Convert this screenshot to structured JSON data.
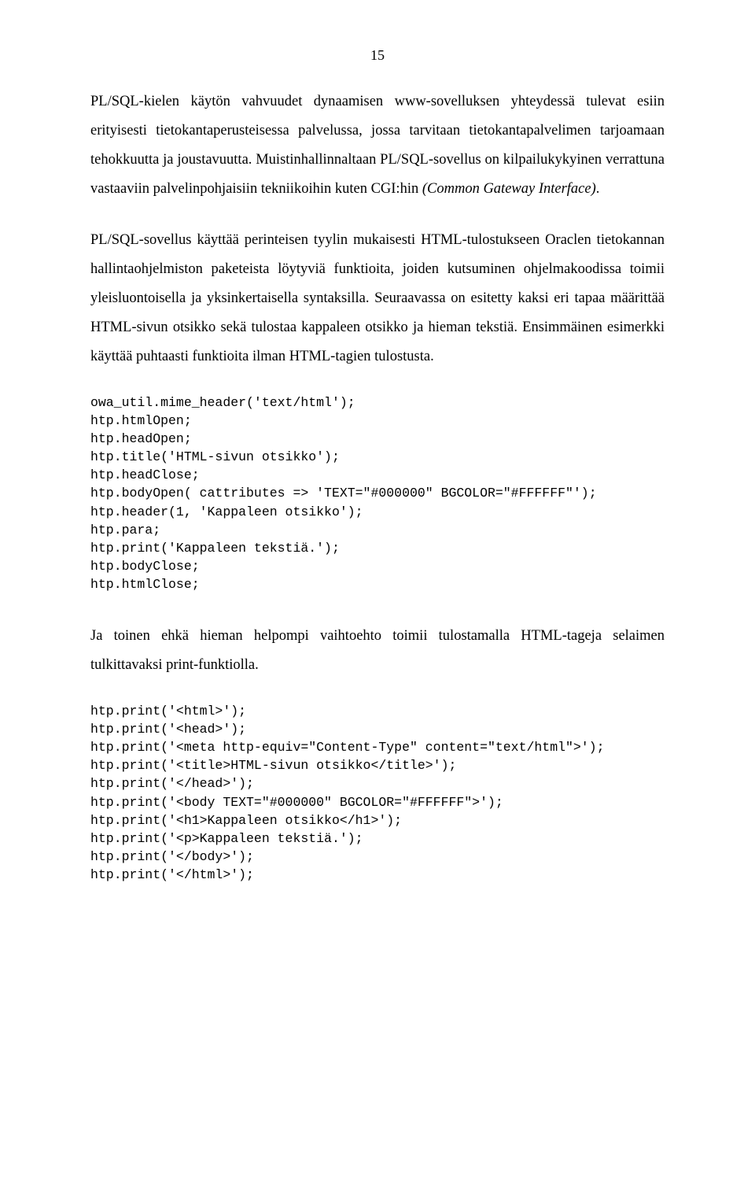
{
  "pageNumber": "15",
  "para1": "PL/SQL-kielen käytön vahvuudet dynaamisen www-sovelluksen yhteydessä tulevat esiin erityisesti tietokantaperusteisessa palvelussa, jossa tarvitaan tietokantapalvelimen tarjoamaan tehokkuutta ja joustavuutta. Muistinhallinnaltaan PL/SQL-sovellus on kilpailukykyinen verrattuna vastaaviin palvelinpohjaisiin tekniikoihin kuten CGI:hin ",
  "para1_italic": "(Common Gateway Interface)",
  "para1_end": ".",
  "para2": "PL/SQL-sovellus käyttää perinteisen tyylin mukaisesti HTML-tulostukseen Oraclen tietokannan hallintaohjelmiston paketeista löytyviä funktioita, joiden kutsuminen ohjelmakoodissa toimii yleisluontoisella ja yksinkertaisella syntaksilla. Seuraavassa on esitetty kaksi eri tapaa määrittää HTML-sivun otsikko sekä tulostaa kappaleen otsikko ja hieman tekstiä. Ensimmäinen esimerkki käyttää puhtaasti funktioita ilman HTML-tagien tulostusta.",
  "code1": "owa_util.mime_header('text/html');\nhtp.htmlOpen;\nhtp.headOpen;\nhtp.title('HTML-sivun otsikko');\nhtp.headClose;\nhtp.bodyOpen( cattributes => 'TEXT=\"#000000\" BGCOLOR=\"#FFFFFF\"');\nhtp.header(1, 'Kappaleen otsikko');\nhtp.para;\nhtp.print('Kappaleen tekstiä.');\nhtp.bodyClose;\nhtp.htmlClose;",
  "para3": "Ja toinen ehkä hieman helpompi vaihtoehto toimii tulostamalla HTML-tageja selaimen tulkittavaksi print-funktiolla.",
  "code2": "htp.print('<html>');\nhtp.print('<head>');\nhtp.print('<meta http-equiv=\"Content-Type\" content=\"text/html\">');\nhtp.print('<title>HTML-sivun otsikko</title>');\nhtp.print('</head>');\nhtp.print('<body TEXT=\"#000000\" BGCOLOR=\"#FFFFFF\">');\nhtp.print('<h1>Kappaleen otsikko</h1>');\nhtp.print('<p>Kappaleen tekstiä.');\nhtp.print('</body>');\nhtp.print('</html>');"
}
